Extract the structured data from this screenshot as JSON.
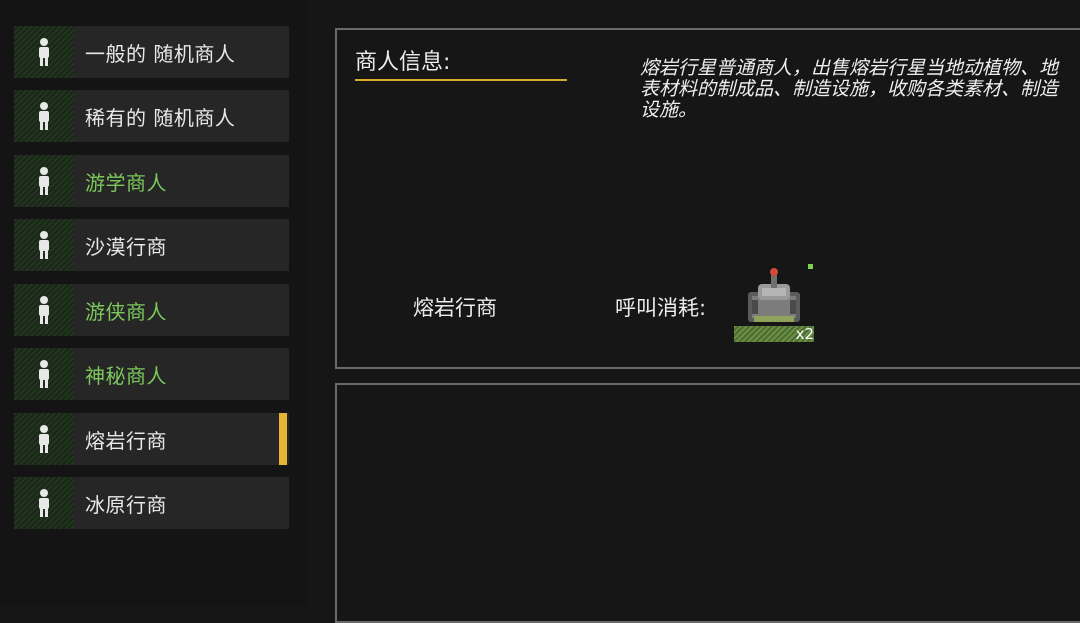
{
  "traders": [
    {
      "label": "一般的 随机商人",
      "color": "normal",
      "selected": false
    },
    {
      "label": "稀有的 随机商人",
      "color": "normal",
      "selected": false
    },
    {
      "label": "游学商人",
      "color": "green",
      "selected": false
    },
    {
      "label": "沙漠行商",
      "color": "normal",
      "selected": false
    },
    {
      "label": "游侠商人",
      "color": "green",
      "selected": false
    },
    {
      "label": "神秘商人",
      "color": "green",
      "selected": false
    },
    {
      "label": "熔岩行商",
      "color": "normal",
      "selected": true
    },
    {
      "label": "冰原行商",
      "color": "normal",
      "selected": false
    }
  ],
  "info": {
    "title": "商人信息:",
    "description": "熔岩行星普通商人，出售熔岩行星当地动植物、地表材料的制成品、制造设施，收购各类素材、制造设施。",
    "trader_name": "熔岩行商",
    "cost_label": "呼叫消耗:",
    "cost_item_icon": "turret-icon",
    "cost_count": "x2"
  },
  "colors": {
    "accent": "#e9b434",
    "green_label": "#7cc85c",
    "panel_border": "#6a6a6a"
  }
}
